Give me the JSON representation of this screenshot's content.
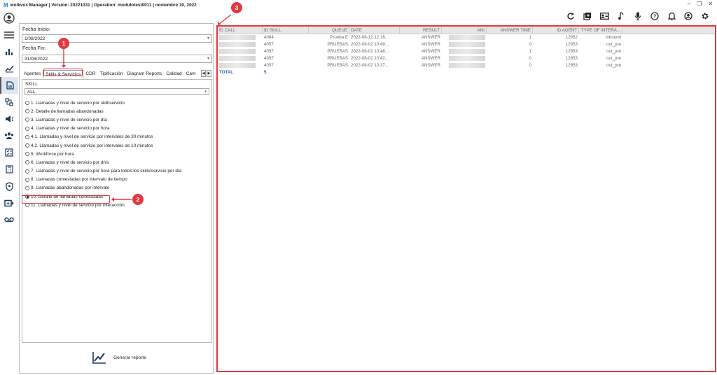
{
  "title": {
    "logo": "M",
    "text": "wolkvox Manager  | Version: 20221031  |  Operation: modulotest0011  |  noviembre 10, 2022"
  },
  "window_controls": {
    "minimize": "–",
    "restore": "❐",
    "close": "✕"
  },
  "toolbar_icons": [
    "refresh-icon",
    "queue-icon",
    "contact-card-icon",
    "music-note-icon",
    "microphone-icon",
    "help-icon",
    "bell-icon",
    "user-circle-icon",
    "gear-icon"
  ],
  "nav_icons": [
    "user-avatar-icon",
    "menu-icon",
    "bar-chart-icon",
    "analytics-icon",
    "reports-icon",
    "hierarchy-icon",
    "campaign-icon",
    "agents-group-icon",
    "checklist-icon",
    "calculator-icon",
    "shield-icon",
    "video-icon",
    "voicemail-icon"
  ],
  "filters": {
    "fecha_inicio_label": "Fecha Inicio:",
    "fecha_inicio": "1/08/2022",
    "fecha_fin_label": "Fecha Fin:",
    "fecha_fin": "31/08/2022"
  },
  "tabs": [
    "Agentes",
    "Skills & Servicios",
    "CDR",
    "Tipificación",
    "Diagram Reports",
    "Calidad",
    "Cam"
  ],
  "skill": {
    "label": "SKILL",
    "value": "ALL"
  },
  "reports": [
    "1. Llamadas y nivel de servicio por skill/servicio",
    "2. Detalle de llamadas abandonadas",
    "3. Llamadas y nivel de servicio por día",
    "4. Llamadas y nivel de servicio por hora",
    "4.1. Llamadas y nivel de servicio por intervalos de 30 minutos",
    "4.2. Llamadas y nivel de servicio por intervalos de 10 minutos",
    "5. Workforce por hora",
    "6. Llamadas y nivel de servicio por dnis",
    "7. Llamadas y nivel de servicio por hora para todos los skills/servicio por día",
    "8. Llamadas contestadas por intervalo de tiempo",
    "9. Llamadas abandonadas por intervalo",
    "10. Detalle de llamadas contestadas",
    "11. Llamadas y nivel de servicio por interacción"
  ],
  "selected_report_index": 11,
  "generate_label": "Generar reporte",
  "grid": {
    "headers": [
      "ID CALL",
      "ID SKILL",
      "QUEUE",
      "DATE",
      "RESULT",
      "ANI",
      "ANSWER TIME",
      "ID AGENT",
      "TYPE OF INTERA..."
    ],
    "rows": [
      [
        "",
        "4064",
        "Prueba E",
        "2022-08-12 12:16...",
        "ANSWER",
        "",
        "1",
        "12952",
        "inbound"
      ],
      [
        "",
        "4057",
        "PRUEBAS",
        "2022-08-02 10:49...",
        "ANSWER",
        "",
        "0",
        "12953",
        "out_pre"
      ],
      [
        "",
        "4057",
        "PRUEBAS",
        "2022-08-02 10:48...",
        "ANSWER",
        "",
        "1",
        "12953",
        "out_pre"
      ],
      [
        "",
        "4057",
        "PRUEBAS",
        "2022-08-02 10:42...",
        "ANSWER",
        "",
        "0",
        "12953",
        "out_pre"
      ],
      [
        "",
        "4057",
        "PRUEBAS",
        "2022-08-02 10:37...",
        "ANSWER",
        "",
        "0",
        "12953",
        "out_pre"
      ]
    ],
    "total_label": "TOTAL",
    "total_value": "5"
  },
  "callouts": [
    "1",
    "2",
    "3"
  ],
  "colors": {
    "accent": "#e0393e",
    "total": "#1f63b5"
  }
}
